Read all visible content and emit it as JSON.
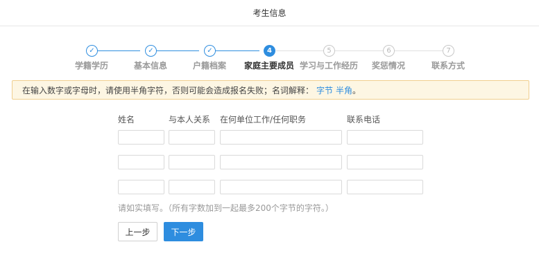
{
  "header": {
    "title": "考生信息"
  },
  "steps": [
    {
      "label": "学籍学历",
      "marker": "✓",
      "state": "done"
    },
    {
      "label": "基本信息",
      "marker": "✓",
      "state": "done"
    },
    {
      "label": "户籍档案",
      "marker": "✓",
      "state": "done"
    },
    {
      "label": "家庭主要成员",
      "marker": "4",
      "state": "active"
    },
    {
      "label": "学习与工作经历",
      "marker": "5",
      "state": "todo"
    },
    {
      "label": "奖惩情况",
      "marker": "6",
      "state": "todo"
    },
    {
      "label": "联系方式",
      "marker": "7",
      "state": "todo"
    }
  ],
  "notice": {
    "text": "在输入数字或字母时，请使用半角字符，否则可能会造成报名失败；名词解释：",
    "link1": "字节",
    "link2": "半角",
    "end": "。"
  },
  "form": {
    "columns": [
      "姓名",
      "与本人关系",
      "在何单位工作/任何职务",
      "联系电话"
    ],
    "rows": [
      [
        "",
        "",
        "",
        ""
      ],
      [
        "",
        "",
        "",
        ""
      ],
      [
        "",
        "",
        "",
        ""
      ]
    ],
    "hint": "请如实填写。（所有字数加到一起最多200个字节的字符。）"
  },
  "buttons": {
    "prev": "上一步",
    "next": "下一步"
  },
  "colors": {
    "accent": "#2e8ddf",
    "notice_bg": "#fdf6e3",
    "notice_border": "#f0cf8e"
  }
}
